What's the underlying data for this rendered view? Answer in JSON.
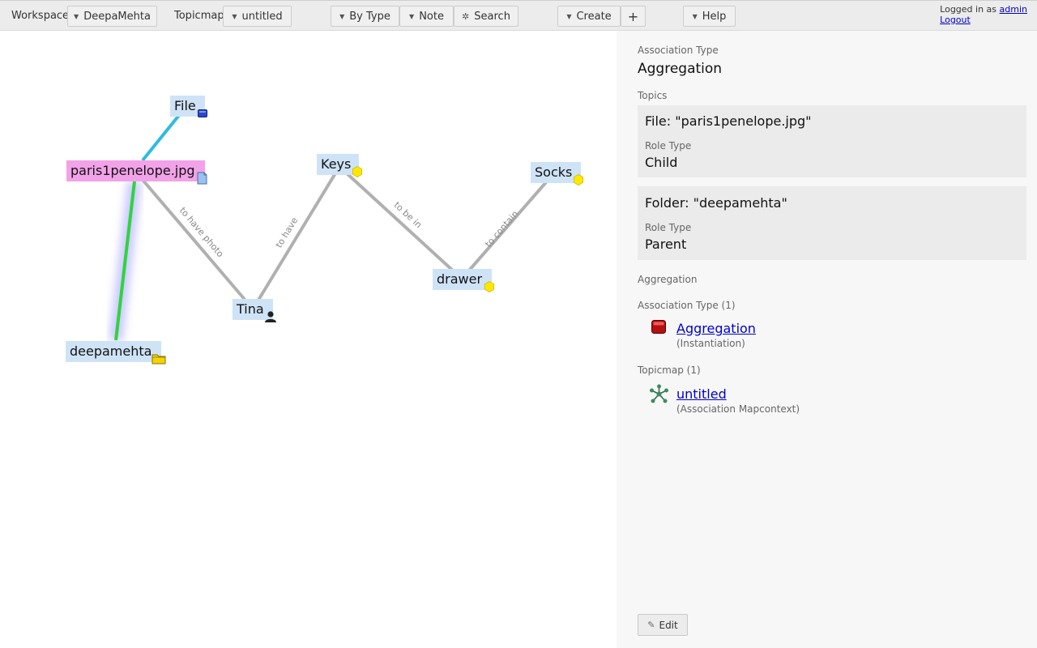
{
  "toolbar": {
    "workspace_label": "Workspace",
    "workspace_value": "DeepaMehta",
    "topicmap_label": "Topicmap",
    "topicmap_value": "untitled",
    "by_type": "By Type",
    "note": "Note",
    "search": "Search",
    "create": "Create",
    "add": "+",
    "help": "Help",
    "logged_in_text": "Logged in as",
    "user": "admin",
    "logout": "Logout"
  },
  "topicmap": {
    "topics": [
      {
        "label": "File",
        "icon": "file-type-icon"
      },
      {
        "label": "paris1penelope.jpg",
        "icon": "file-icon",
        "selected": true
      },
      {
        "label": "Keys",
        "icon": "item-dot-icon"
      },
      {
        "label": "Socks",
        "icon": "item-dot-icon"
      },
      {
        "label": "drawer",
        "icon": "item-dot-icon"
      },
      {
        "label": "Tina",
        "icon": "person-icon"
      },
      {
        "label": "deepamehta",
        "icon": "folder-icon"
      }
    ],
    "associations": [
      {
        "label": "to have photo"
      },
      {
        "label": "to have"
      },
      {
        "label": "to be in"
      },
      {
        "label": "to contain"
      }
    ],
    "colors": {
      "topic_bg": "#cfe3f7",
      "selected_topic_bg": "#f2a2e8",
      "assoc_default": "#b0b0b0",
      "assoc_instantiation": "#2fbbe0",
      "assoc_aggregation": "#2fd43c"
    }
  },
  "detail": {
    "association_type_label": "Association Type",
    "association_type_value": "Aggregation",
    "topics_label": "Topics",
    "topic1_title": "File: \"paris1penelope.jpg\"",
    "topic1_role_label": "Role Type",
    "topic1_role_value": "Child",
    "topic2_title": "Folder: \"deepamehta\"",
    "topic2_role_label": "Role Type",
    "topic2_role_value": "Parent",
    "section_label": "Aggregation",
    "rel1_header": "Association Type (1)",
    "rel1_link": "Aggregation",
    "rel1_sub": "(Instantiation)",
    "rel2_header": "Topicmap (1)",
    "rel2_link": "untitled",
    "rel2_sub": "(Association Mapcontext)",
    "edit": "Edit"
  }
}
